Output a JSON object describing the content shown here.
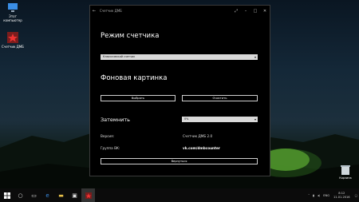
{
  "desktop": {
    "icons": [
      {
        "label": "Этот компьютер",
        "icon": "computer-icon"
      },
      {
        "label": "Счетчик ДМБ",
        "icon": "army-star-icon"
      }
    ],
    "recycle_bin": {
      "label": "Корзина",
      "icon": "recycle-bin-icon"
    }
  },
  "window": {
    "title": "Счетчик ДМБ",
    "controls": {
      "back": "←",
      "fullscreen": "⤢",
      "minimize": "–",
      "maximize": "□",
      "close": "✕"
    },
    "counter_mode": {
      "heading": "Режим счетчика",
      "selected": "Классический счетчик"
    },
    "background": {
      "heading": "Фоновая картинка",
      "choose_label": "Выбрать",
      "clear_label": "Очистить"
    },
    "dim": {
      "label": "Затемнить",
      "selected": "0%"
    },
    "info": {
      "version_label": "Версия:",
      "version_value": "Счетчик ДМБ 2.0",
      "group_label": "Группа ВК:",
      "group_value": "vk.com/dmbcounter"
    },
    "back_button_label": "Вернуться"
  },
  "taskbar": {
    "items": [
      "windows-logo-icon",
      "search-icon",
      "task-view-icon",
      "edge-icon",
      "folder-icon",
      "store-icon",
      "app-icon"
    ],
    "tray": {
      "language": "ENG",
      "time": "8:12",
      "date": "11.01.2016"
    }
  }
}
